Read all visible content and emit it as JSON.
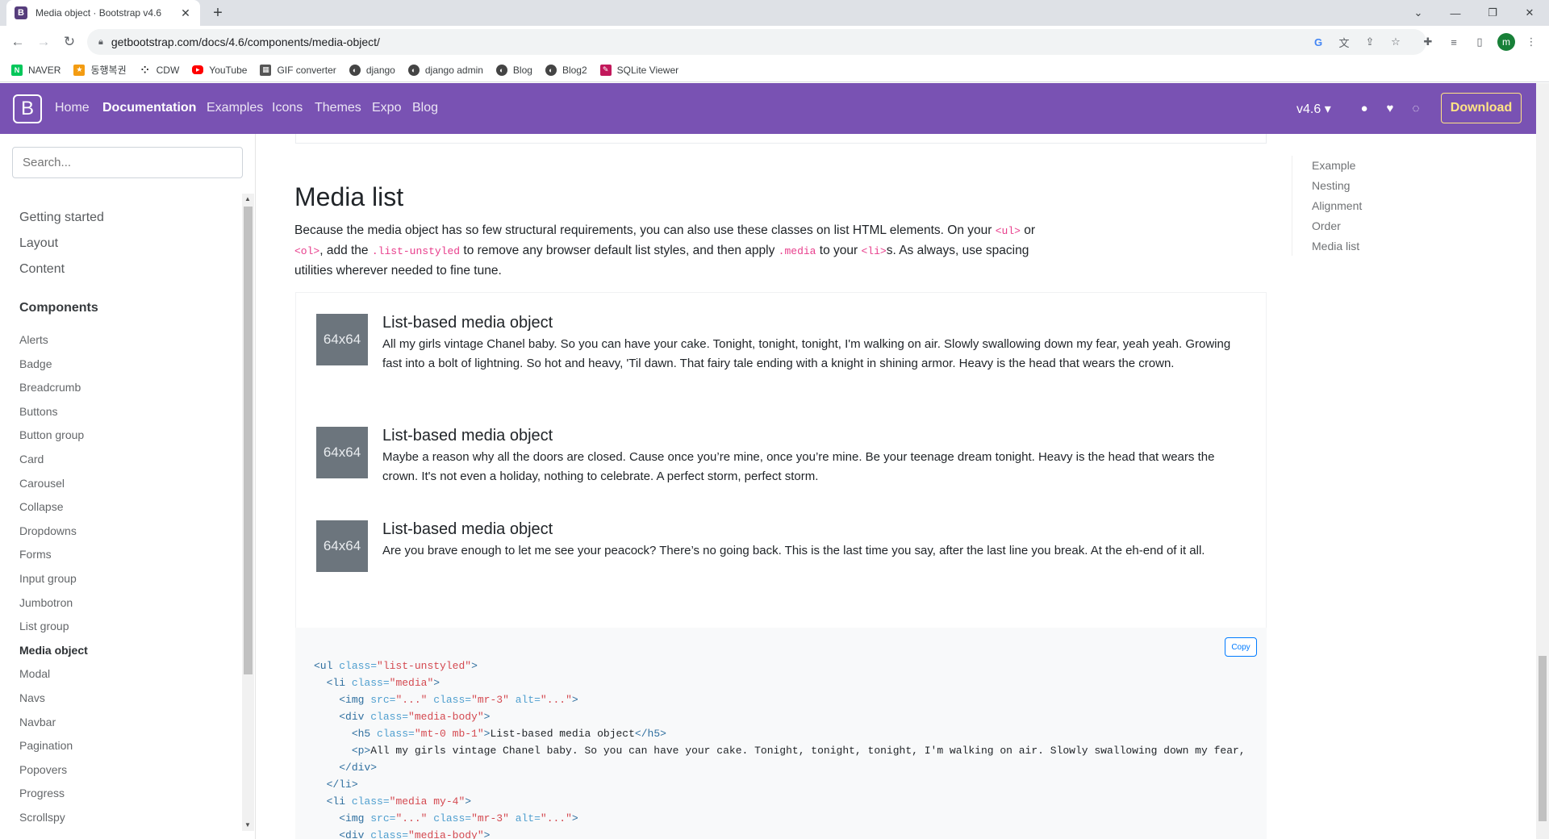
{
  "browser": {
    "tab_title": "Media object · Bootstrap v4.6",
    "favicon_letter": "B",
    "url": "getbootstrap.com/docs/4.6/components/media-object/",
    "profile_letter": "m"
  },
  "bookmarks": [
    {
      "label": "NAVER",
      "icon_color": "#03c75a"
    },
    {
      "label": "동행복권",
      "icon_color": "#f39c12"
    },
    {
      "label": "CDW",
      "icon_color": "#222222"
    },
    {
      "label": "YouTube",
      "icon_color": "#ff0000"
    },
    {
      "label": "GIF converter",
      "icon_color": "#444444"
    },
    {
      "label": "django",
      "icon_color": "#444444"
    },
    {
      "label": "django admin",
      "icon_color": "#444444"
    },
    {
      "label": "Blog",
      "icon_color": "#444444"
    },
    {
      "label": "Blog2",
      "icon_color": "#444444"
    },
    {
      "label": "SQLite Viewer",
      "icon_color": "#c2185b"
    }
  ],
  "navbar": {
    "logo": "B",
    "links": [
      "Home",
      "Documentation",
      "Examples",
      "Icons",
      "Themes",
      "Expo",
      "Blog"
    ],
    "version": "v4.6 ▾",
    "download": "Download",
    "brand_color": "#7952b3"
  },
  "sidebar": {
    "search_placeholder": "Search...",
    "sections": [
      "Getting started",
      "Layout",
      "Content",
      "Components"
    ],
    "components": [
      "Alerts",
      "Badge",
      "Breadcrumb",
      "Buttons",
      "Button group",
      "Card",
      "Carousel",
      "Collapse",
      "Dropdowns",
      "Forms",
      "Input group",
      "Jumbotron",
      "List group",
      "Media object",
      "Modal",
      "Navs",
      "Navbar",
      "Pagination",
      "Popovers",
      "Progress",
      "Scrollspy"
    ],
    "active": "Media object"
  },
  "main": {
    "heading": "Media list",
    "lead": {
      "t1": "Because the media object has so few structural requirements, you can also use these classes on list HTML elements. On your ",
      "c1": "<ul>",
      "t2": " or ",
      "c2": "<ol>",
      "t3": ", add the ",
      "c3": ".list-unstyled",
      "t4": " to remove any browser default list styles, and then apply ",
      "c4": ".media",
      "t5": " to your ",
      "c5": "<li>",
      "t6": "s. As always, use spacing utilities wherever needed to fine tune."
    },
    "placeholder_label": "64x64",
    "items": [
      {
        "title": "List-based media object",
        "text": "All my girls vintage Chanel baby. So you can have your cake. Tonight, tonight, tonight, I'm walking on air. Slowly swallowing down my fear, yeah yeah. Growing fast into a bolt of lightning. So hot and heavy, 'Til dawn. That fairy tale ending with a knight in shining armor. Heavy is the head that wears the crown."
      },
      {
        "title": "List-based media object",
        "text": "Maybe a reason why all the doors are closed. Cause once you’re mine, once you’re mine. Be your teenage dream tonight. Heavy is the head that wears the crown. It's not even a holiday, nothing to celebrate. A perfect storm, perfect storm."
      },
      {
        "title": "List-based media object",
        "text": "Are you brave enough to let me see your peacock? There’s no going back. This is the last time you say, after the last line you break. At the eh-end of it all."
      }
    ],
    "copy_label": "Copy",
    "code": {
      "l1": {
        "o": "<ul ",
        "a": "class=",
        "s": "\"list-unstyled\"",
        "c": ">"
      },
      "l2": {
        "o": "<li ",
        "a": "class=",
        "s": "\"media\"",
        "c": ">"
      },
      "l3": {
        "o": "<img ",
        "a1": "src=",
        "s1": "\"...\"",
        "a2": " class=",
        "s2": "\"mr-3\"",
        "a3": " alt=",
        "s3": "\"...\"",
        "c": ">"
      },
      "l4": {
        "o": "<div ",
        "a": "class=",
        "s": "\"media-body\"",
        "c": ">"
      },
      "l5": {
        "o": "<h5 ",
        "a": "class=",
        "s": "\"mt-0 mb-1\"",
        "c": ">",
        "t": "List-based media object",
        "e": "</h5>"
      },
      "l6": {
        "o": "<p>",
        "t": "All my girls vintage Chanel baby. So you can have your cake. Tonight, tonight, tonight, I'm walking on air. Slowly swallowing down my fear, yeah yeah."
      },
      "l7": "</div>",
      "l8": "</li>",
      "l9": {
        "o": "<li ",
        "a": "class=",
        "s": "\"media my-4\"",
        "c": ">"
      },
      "l10": {
        "o": "<img ",
        "a1": "src=",
        "s1": "\"...\"",
        "a2": " class=",
        "s2": "\"mr-3\"",
        "a3": " alt=",
        "s3": "\"...\"",
        "c": ">"
      },
      "l11": {
        "o": "<div ",
        "a": "class=",
        "s": "\"media-body\"",
        "c": ">"
      }
    }
  },
  "toc": [
    "Example",
    "Nesting",
    "Alignment",
    "Order",
    "Media list"
  ]
}
